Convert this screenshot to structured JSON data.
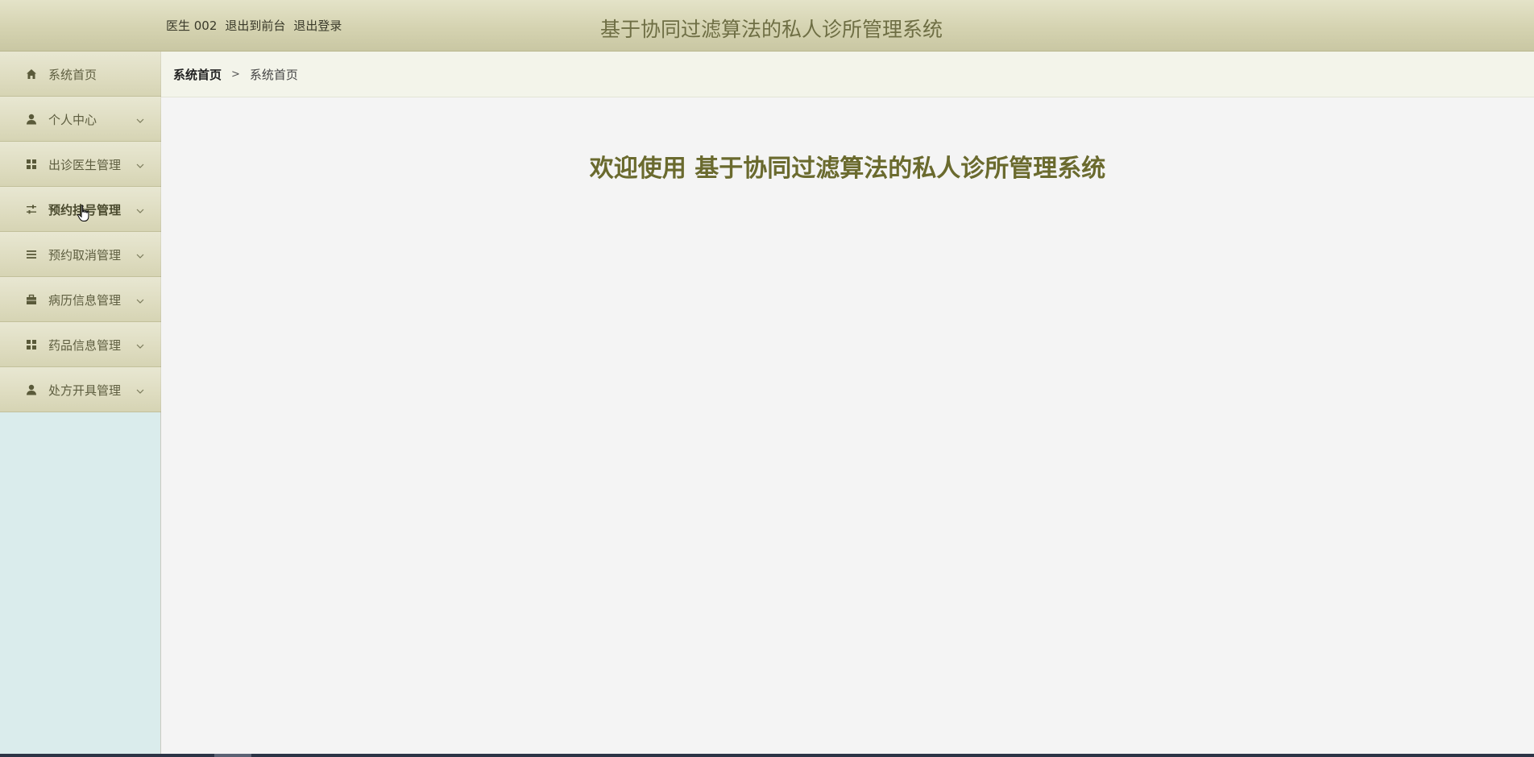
{
  "header": {
    "user_label": "医生 002",
    "front_link": "退出到前台",
    "logout_link": "退出登录",
    "app_title": "基于协同过滤算法的私人诊所管理系统"
  },
  "sidebar": {
    "items": [
      {
        "label": "系统首页",
        "icon": "home-icon"
      },
      {
        "label": "个人中心",
        "icon": "user-icon"
      },
      {
        "label": "出诊医生管理",
        "icon": "grid-icon"
      },
      {
        "label": "预约挂号管理",
        "icon": "sliders-icon"
      },
      {
        "label": "预约取消管理",
        "icon": "list-icon"
      },
      {
        "label": "病历信息管理",
        "icon": "briefcase-icon"
      },
      {
        "label": "药品信息管理",
        "icon": "grid-icon"
      },
      {
        "label": "处方开具管理",
        "icon": "user-icon"
      }
    ]
  },
  "breadcrumb": {
    "home": "系统首页",
    "separator": ">",
    "current": "系统首页"
  },
  "main": {
    "welcome": "欢迎使用 基于协同过滤算法的私人诊所管理系统"
  },
  "colors": {
    "accent_text": "#6a6a2e",
    "icon": "#5a5a3a",
    "sidebar_bg": "#daecec"
  }
}
